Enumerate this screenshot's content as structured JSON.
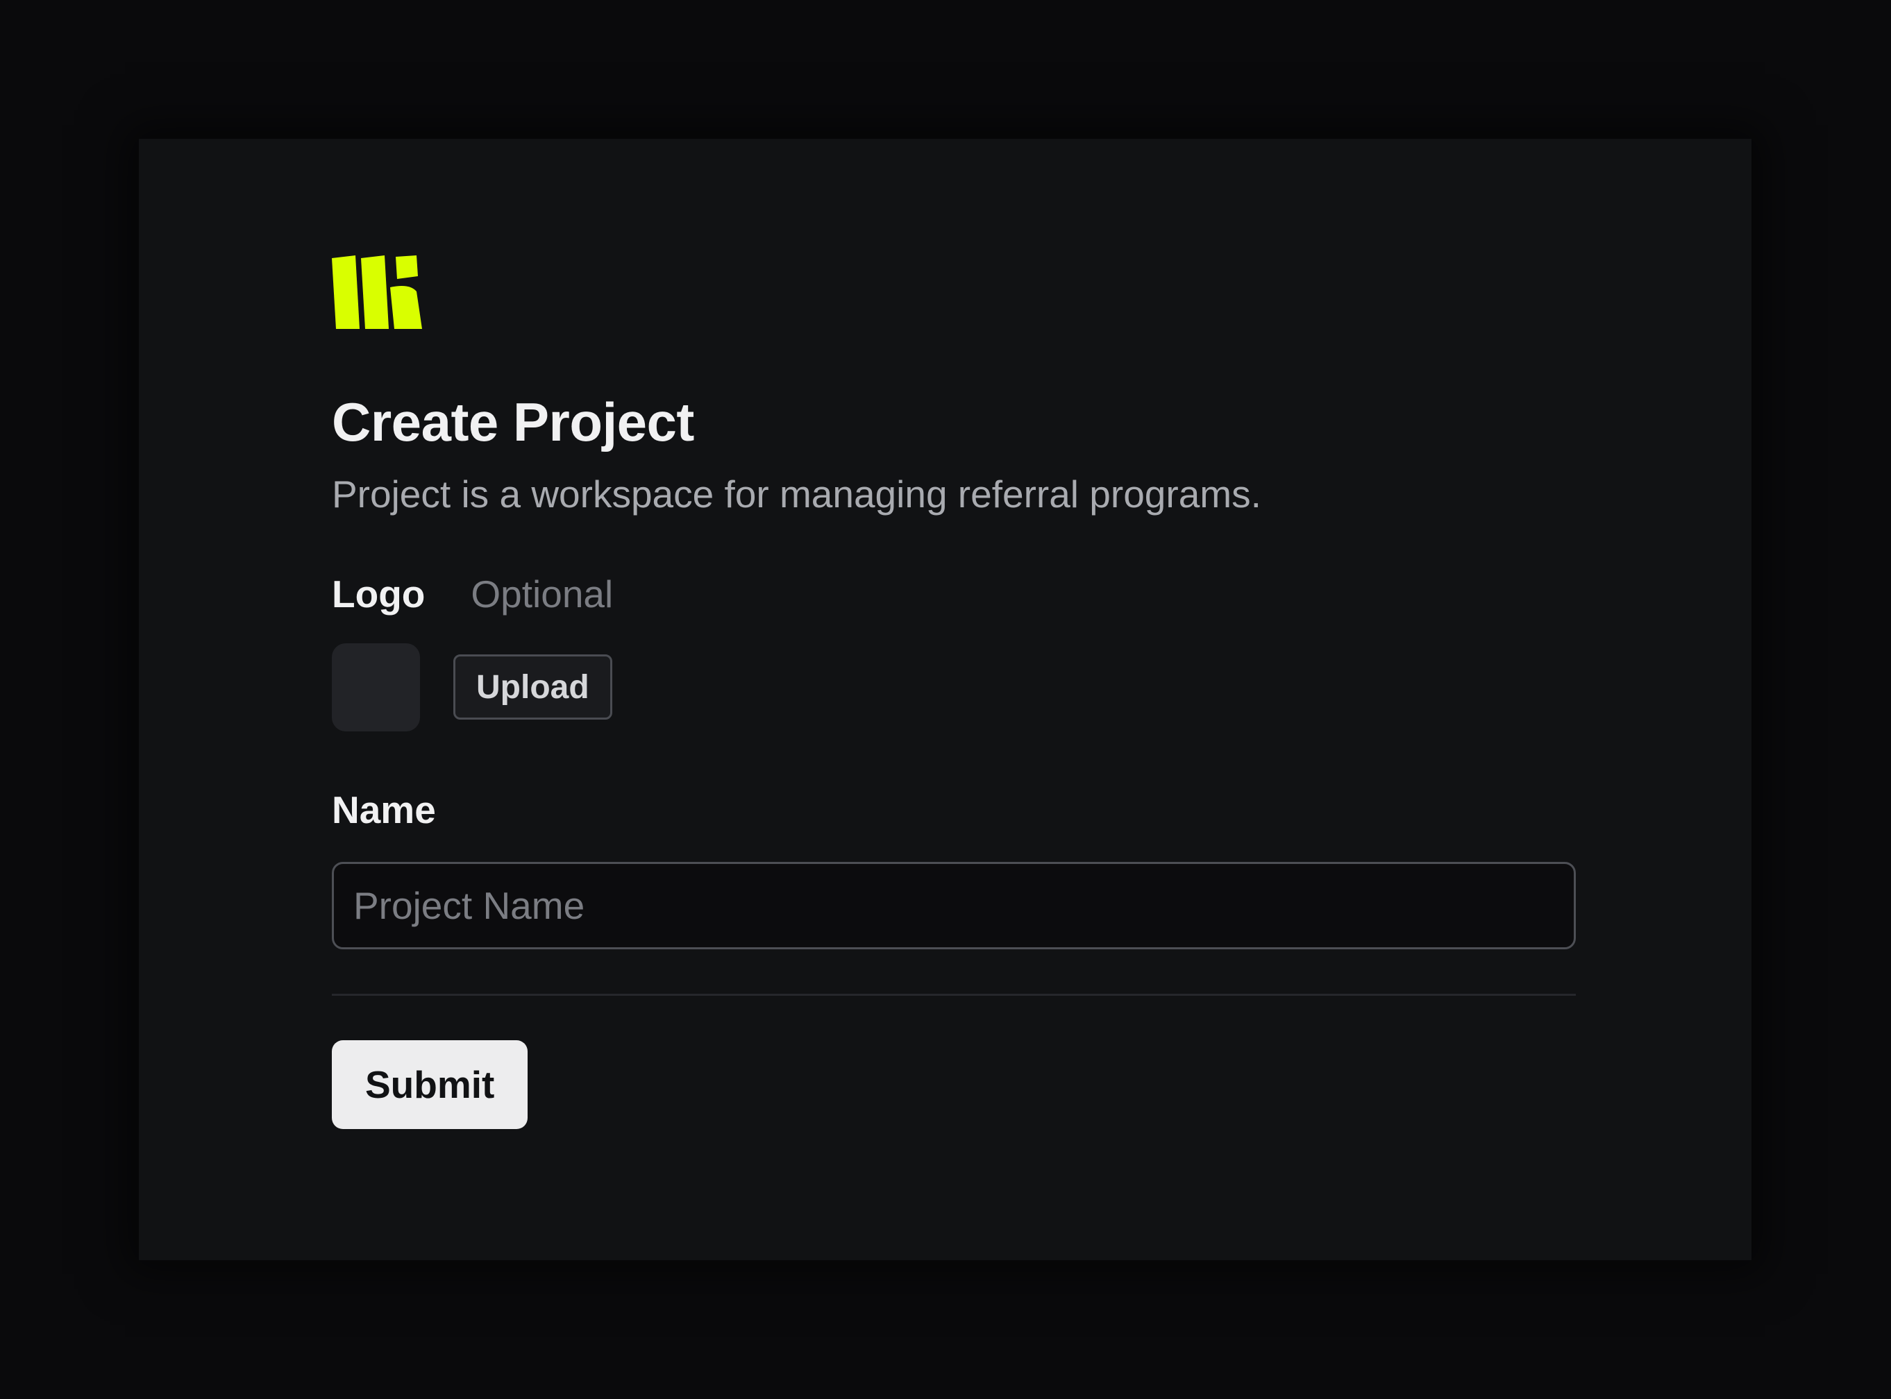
{
  "colors": {
    "background": "#0a0a0c",
    "card": "#111214",
    "brand_accent": "#d9ff00",
    "text_primary": "#f1f1f2",
    "text_secondary": "#a9abb0",
    "text_muted": "#7b7d83",
    "submit_bg": "#ededee"
  },
  "brand": {
    "icon": "brand-logo-icon"
  },
  "header": {
    "title": "Create Project",
    "subtitle": "Project is a workspace for managing referral programs."
  },
  "logo_field": {
    "label": "Logo",
    "optional_label": "Optional",
    "upload_label": "Upload"
  },
  "name_field": {
    "label": "Name",
    "placeholder": "Project Name",
    "value": ""
  },
  "actions": {
    "submit_label": "Submit"
  }
}
